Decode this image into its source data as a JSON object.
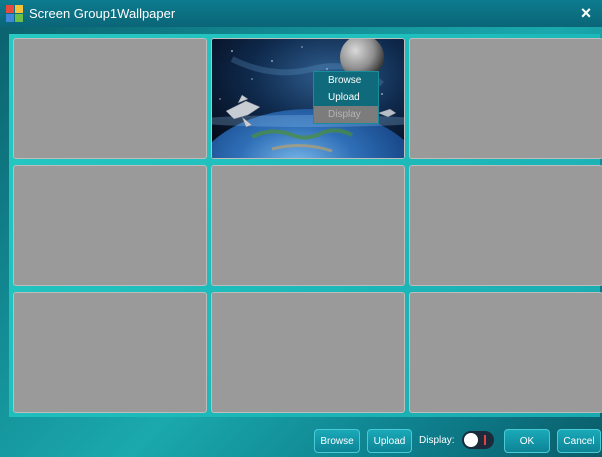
{
  "window": {
    "title": "Screen Group1Wallpaper",
    "close_glyph": "×"
  },
  "context_menu": {
    "items": [
      {
        "label": "Browse",
        "enabled": true
      },
      {
        "label": "Upload",
        "enabled": true
      },
      {
        "label": "Display",
        "enabled": false
      }
    ]
  },
  "toolbar": {
    "browse_label": "Browse",
    "upload_label": "Upload",
    "display_label": "Display:",
    "display_on": false,
    "ok_label": "OK",
    "cancel_label": "Cancel"
  },
  "tiles": {
    "selected_index": 2,
    "count": 9
  },
  "colors": {
    "accent": "#1aa9b8",
    "tile_empty": "#9a9a9a",
    "toggle_off": "#1b2b3b",
    "toggle_mark": "#e24444"
  },
  "icons": {
    "app": "app-icon",
    "close": "close-icon"
  }
}
